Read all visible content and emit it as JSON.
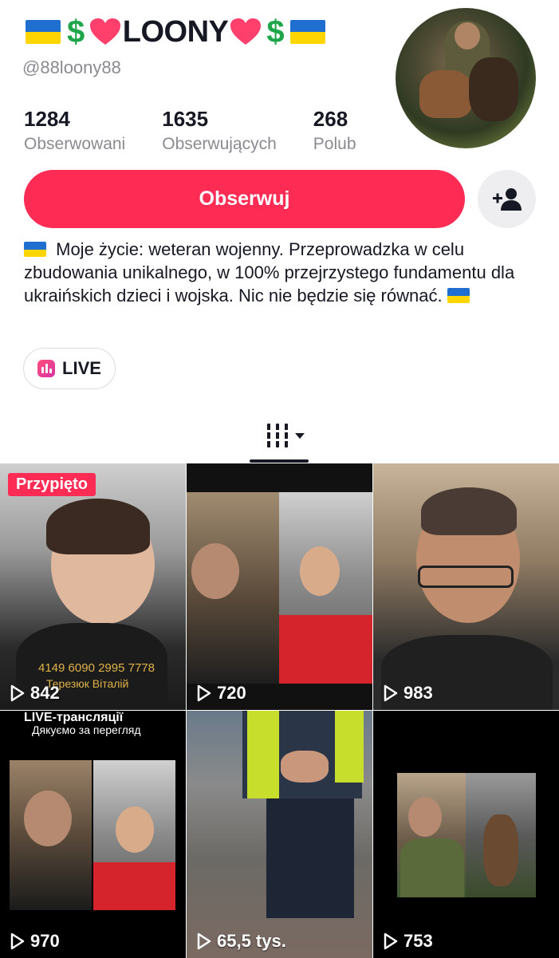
{
  "profile": {
    "display_name": "LOONY",
    "handle": "@88loony88",
    "stats": [
      {
        "value": "1284",
        "label": "Obserwowani"
      },
      {
        "value": "1635",
        "label": "Obserwujących"
      },
      {
        "value": "268",
        "label": "Polub"
      }
    ],
    "follow_label": "Obserwuj",
    "bio": "Moje życie: weteran wojenny. Przeprowadzka w celu zbudowania unikalnego, w 100% przejrzystego fundamentu dla ukraińskich dzieci i wojska. Nic nie będzie się równać.",
    "live_label": "LIVE"
  },
  "colors": {
    "accent": "#fe2c55",
    "muted": "#8a8b91",
    "money": "#1fa64a"
  },
  "videos": [
    {
      "views": "842",
      "pinned_label": "Przypięto",
      "card_number": "4149 6090 2995 7778",
      "card_name": "Терезюк Віталій"
    },
    {
      "views": "720"
    },
    {
      "views": "983"
    },
    {
      "views": "970",
      "overlay_title": "LIVE-трансляції",
      "overlay_sub": "Дякуємо за перегляд"
    },
    {
      "views": "65,5 tys."
    },
    {
      "views": "753"
    }
  ]
}
